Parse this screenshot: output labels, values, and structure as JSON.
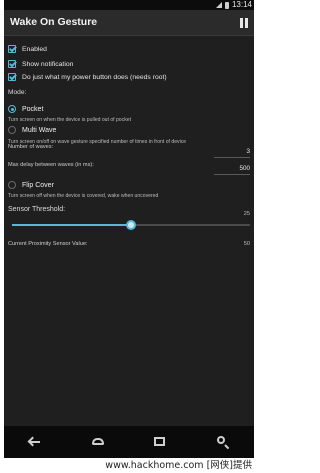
{
  "status_bar": {
    "time": "13:14"
  },
  "app": {
    "title": "Wake On Gesture"
  },
  "toggles": [
    {
      "label": "Enabled",
      "checked": true
    },
    {
      "label": "Show notification",
      "checked": true
    },
    {
      "label": "Do just what my power button does (needs root)",
      "checked": true
    }
  ],
  "mode": {
    "label": "Mode:",
    "options": [
      {
        "label": "Pocket",
        "selected": true,
        "desc": "Turn screen on when the device is pulled out of pocket"
      },
      {
        "label": "Multi Wave",
        "selected": false,
        "desc": "Turn screen on/off on wave gesture specified number of times in front of device"
      },
      {
        "label": "Flip Cover",
        "selected": false,
        "desc": "Turn screen off when the device is covered, wake when uncovered"
      }
    ]
  },
  "multi_wave_fields": {
    "waves_label": "Number of waves:",
    "waves_value": "3",
    "delay_label": "Max delay between waves (in ms):",
    "delay_value": "500"
  },
  "sensor": {
    "threshold_label": "Sensor Threshold:",
    "threshold_max": "25",
    "threshold_level": 0.5,
    "current_label": "Current Proximity Sensor Value:",
    "current_value": "50"
  },
  "watermark": {
    "text": "www.hackhome.com [网侠]提供"
  }
}
